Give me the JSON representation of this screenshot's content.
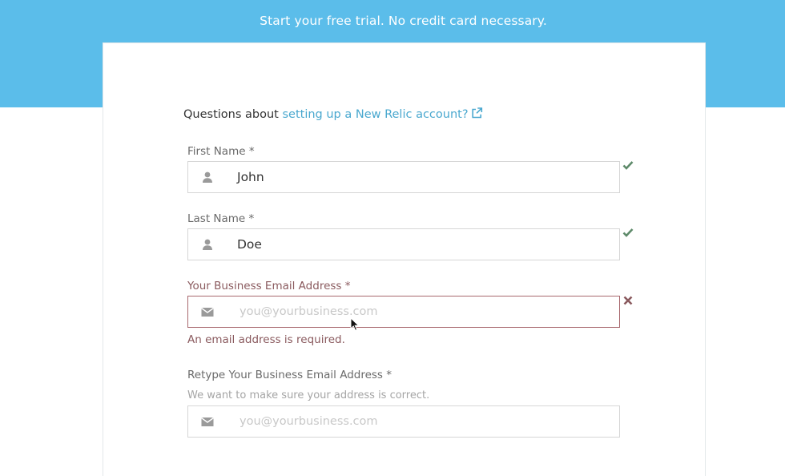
{
  "banner": {
    "text": "Start your free trial. No credit card necessary."
  },
  "intro": {
    "prefix": "Questions about ",
    "link_text": "setting up a New Relic account?"
  },
  "form": {
    "first_name": {
      "label": "First Name *",
      "value": "John",
      "status": "valid"
    },
    "last_name": {
      "label": "Last Name *",
      "value": "Doe",
      "status": "valid"
    },
    "email": {
      "label": "Your Business Email Address *",
      "placeholder": "you@yourbusiness.com",
      "value": "",
      "status": "invalid",
      "error": "An email address is required."
    },
    "email_confirm": {
      "label": "Retype Your Business Email Address *",
      "hint": "We want to make sure your address is correct.",
      "placeholder": "you@yourbusiness.com",
      "value": ""
    }
  },
  "colors": {
    "banner": "#5bbdea",
    "link": "#4aa8cf",
    "valid": "#5e8a6a",
    "invalid": "#8a5a5e"
  },
  "icons": {
    "user": "user-icon",
    "envelope": "envelope-icon",
    "check": "check-icon",
    "cross": "cross-icon",
    "external": "external-link-icon"
  }
}
